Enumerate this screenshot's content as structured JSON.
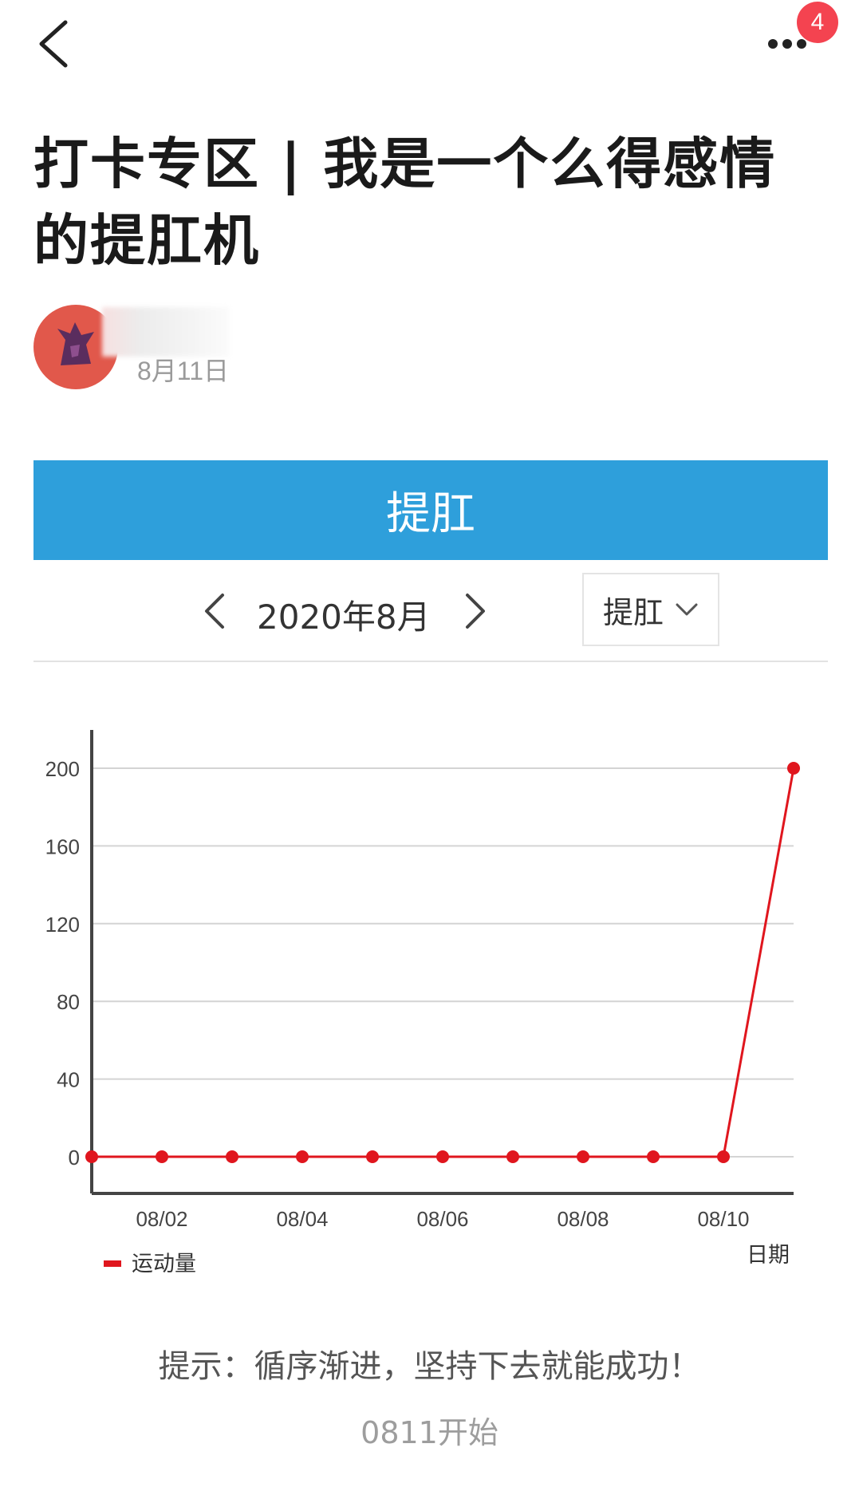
{
  "header": {
    "back_icon": "chevron-left-icon",
    "more_icon": "more-dots-icon",
    "notification_count": "4"
  },
  "post": {
    "title": "打卡专区 | 我是一个么得感情的提肛机",
    "date": "8月11日"
  },
  "banner": {
    "label": "提肛"
  },
  "calendar": {
    "month_label": "2020年8月",
    "selected_type": "提肛"
  },
  "chart_data": {
    "type": "line",
    "x": [
      "08/01",
      "08/02",
      "08/03",
      "08/04",
      "08/05",
      "08/06",
      "08/07",
      "08/08",
      "08/09",
      "08/10",
      "08/11"
    ],
    "series": [
      {
        "name": "运动量",
        "values": [
          0,
          0,
          0,
          0,
          0,
          0,
          0,
          0,
          0,
          0,
          200
        ]
      }
    ],
    "x_tick_labels": [
      "08/02",
      "08/04",
      "08/06",
      "08/08",
      "08/10"
    ],
    "y_ticks": [
      "0",
      "40",
      "80",
      "120",
      "160",
      "200"
    ],
    "ylim": [
      0,
      200
    ],
    "xlabel": "日期",
    "ylabel": "",
    "grid": true,
    "legend_position": "bottom-left",
    "colors": {
      "series": "#e0161e",
      "grid": "#d4d4d4",
      "axis": "#444444"
    }
  },
  "footer": {
    "tip": "提示：循序渐进，坚持下去就能成功！",
    "start_note": "0811开始"
  }
}
